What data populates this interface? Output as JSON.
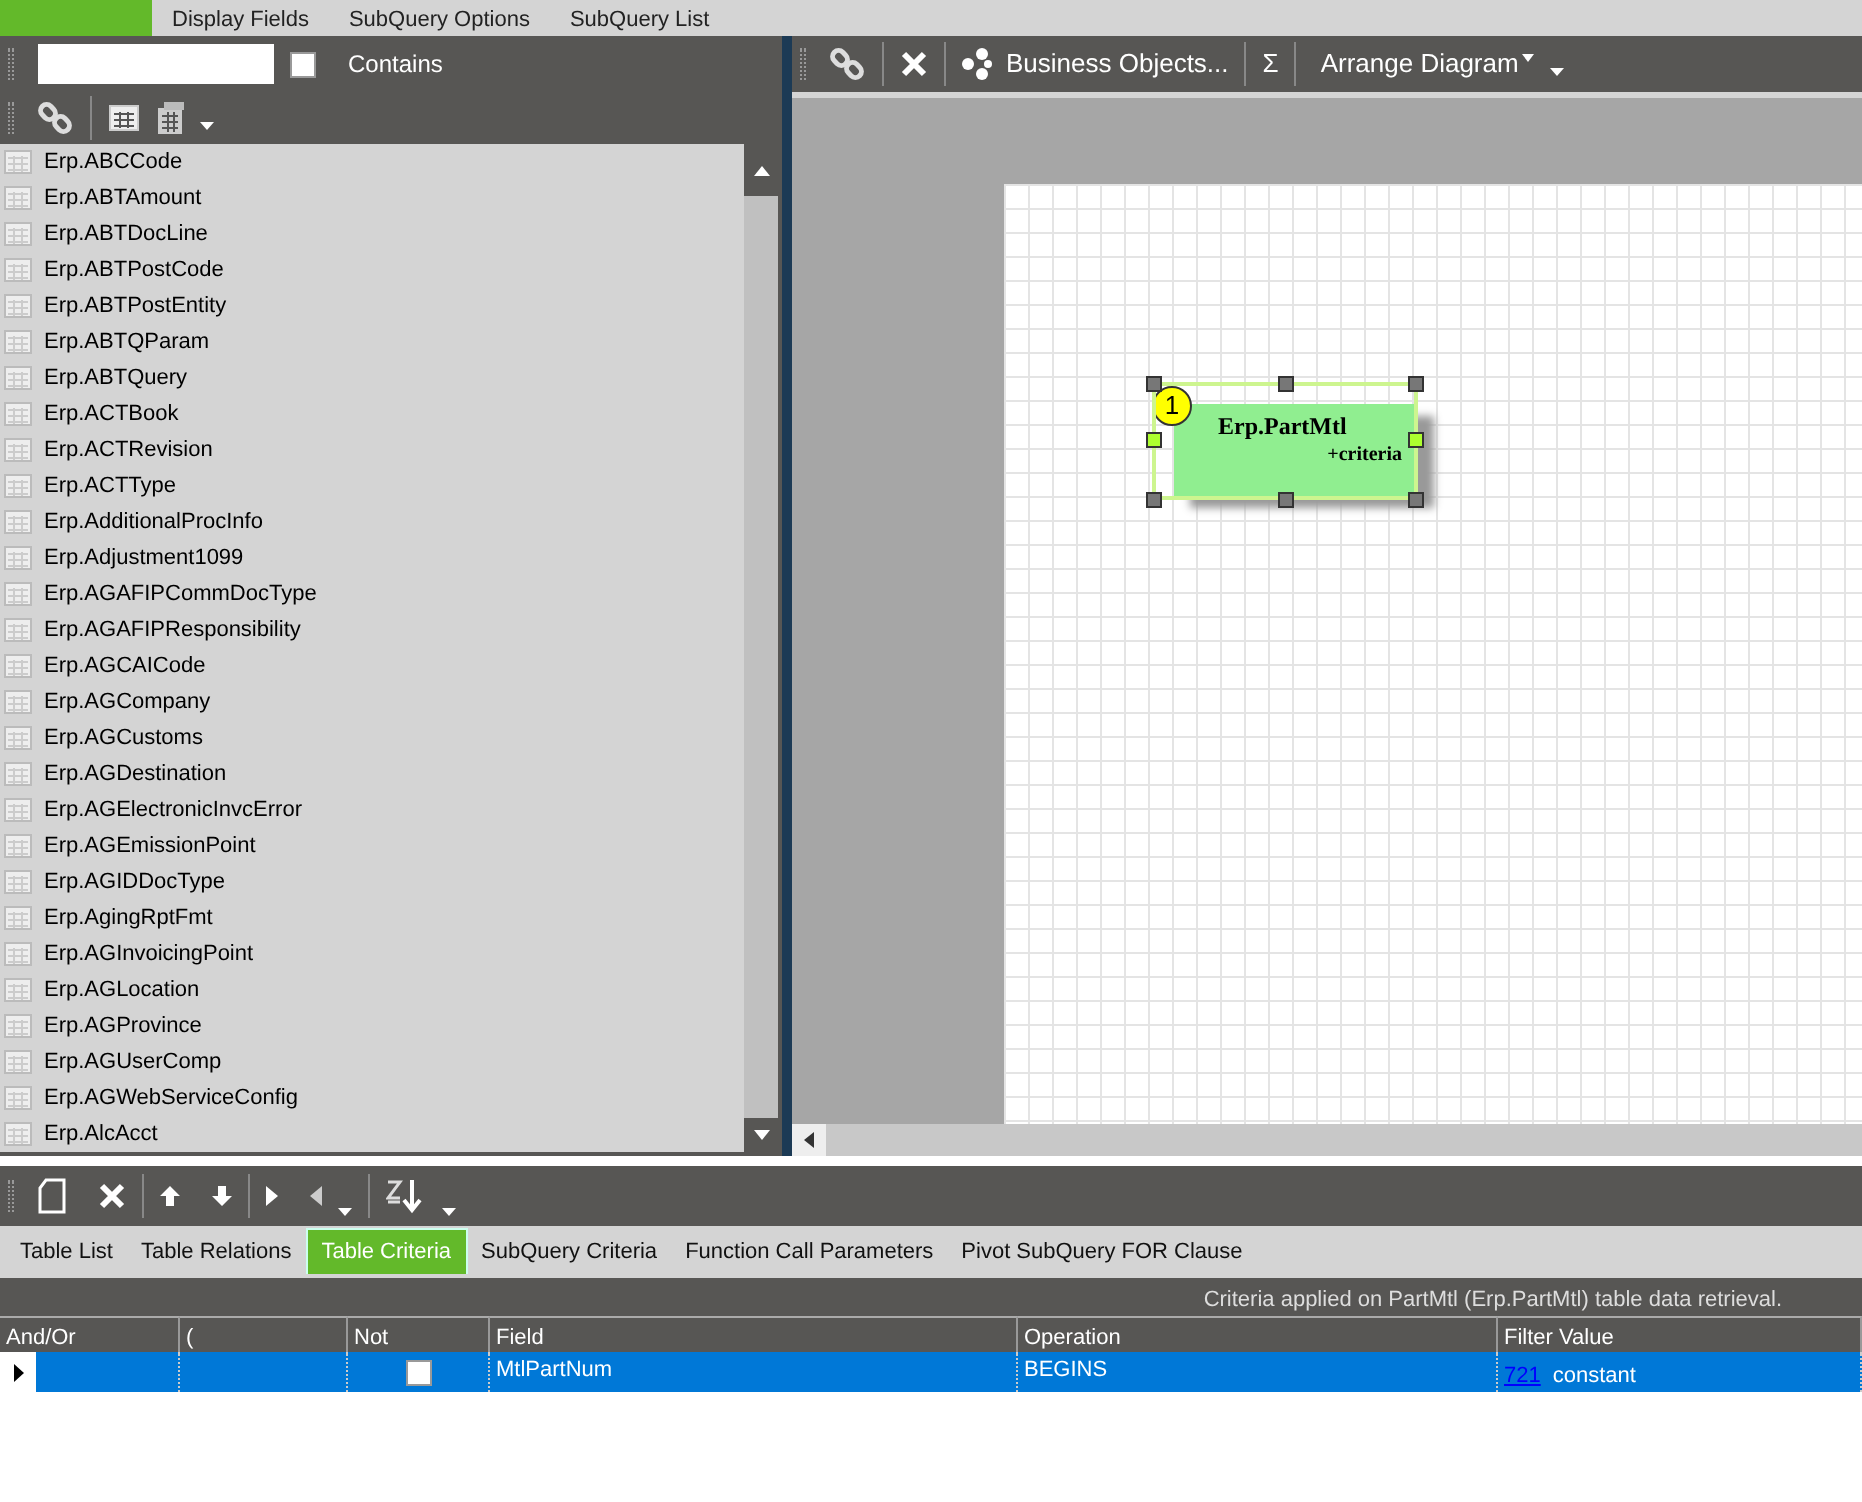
{
  "top_tabs": [
    {
      "selected": true
    },
    {
      "label": "Display Fields",
      "selected": false
    },
    {
      "label": "SubQuery Options",
      "selected": false
    },
    {
      "label": "SubQuery List",
      "selected": false
    }
  ],
  "contains": {
    "label": "Contains",
    "checked": false
  },
  "tables": [
    "Erp.ABCCode",
    "Erp.ABTAmount",
    "Erp.ABTDocLine",
    "Erp.ABTPostCode",
    "Erp.ABTPostEntity",
    "Erp.ABTQParam",
    "Erp.ABTQuery",
    "Erp.ACTBook",
    "Erp.ACTRevision",
    "Erp.ACTType",
    "Erp.AdditionalProcInfo",
    "Erp.Adjustment1099",
    "Erp.AGAFIPCommDocType",
    "Erp.AGAFIPResponsibility",
    "Erp.AGCAICode",
    "Erp.AGCompany",
    "Erp.AGCustoms",
    "Erp.AGDestination",
    "Erp.AGElectronicInvcError",
    "Erp.AGEmissionPoint",
    "Erp.AGIDDocType",
    "Erp.AgingRptFmt",
    "Erp.AGInvoicingPoint",
    "Erp.AGLocation",
    "Erp.AGProvince",
    "Erp.AGUserComp",
    "Erp.AGWebServiceConfig",
    "Erp.AlcAcct"
  ],
  "diagram_toolbar": {
    "business_objects": "Business Objects...",
    "sum": "Σ",
    "arrange": "Arrange Diagram"
  },
  "diagram": {
    "nodes": [
      {
        "number": "1",
        "title": "Erp.PartMtl",
        "subtitle": "+criteria",
        "selected": true
      }
    ]
  },
  "bottom_tabs": [
    {
      "label": "Table List",
      "selected": false
    },
    {
      "label": "Table Relations",
      "selected": false
    },
    {
      "label": "Table Criteria",
      "selected": true
    },
    {
      "label": "SubQuery Criteria",
      "selected": false
    },
    {
      "label": "Function Call Parameters",
      "selected": false
    },
    {
      "label": "Pivot SubQuery FOR Clause",
      "selected": false
    }
  ],
  "info": "Criteria applied on PartMtl (Erp.PartMtl)  table data retrieval.",
  "grid": {
    "columns": [
      "And/Or",
      "(",
      "Not",
      "Field",
      "Operation",
      "Filter Value"
    ],
    "rows": [
      {
        "selected": true,
        "not": false,
        "field": "MtlPartNum",
        "operation": "BEGINS",
        "filter_link": "721",
        "filter_text": "constant"
      }
    ]
  }
}
